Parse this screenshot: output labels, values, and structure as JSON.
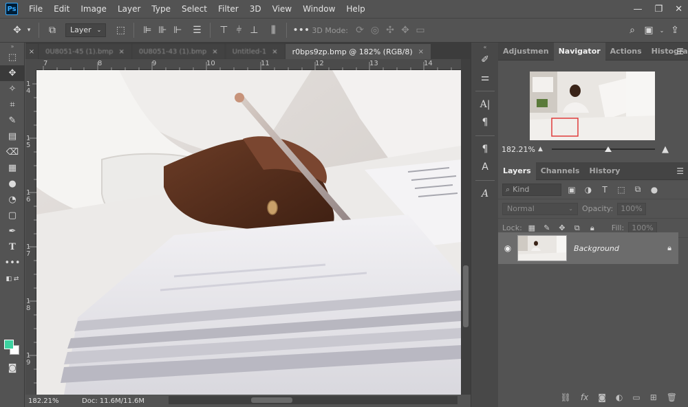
{
  "app": {
    "logo": "Ps",
    "menu": [
      "File",
      "Edit",
      "Image",
      "Layer",
      "Type",
      "Select",
      "Filter",
      "3D",
      "View",
      "Window",
      "Help"
    ],
    "window_controls": [
      "—",
      "❐",
      "✕"
    ]
  },
  "options_bar": {
    "auto_select_value": "Layer",
    "mode_3d_label": "3D Mode:"
  },
  "document": {
    "tabs": [
      {
        "label": "0U8051-45 (1).bmp",
        "active": false
      },
      {
        "label": "0U8051-43 (1).bmp",
        "active": false
      },
      {
        "label": "Untitled-1",
        "active": false
      },
      {
        "label": "r0bps9zp.bmp @ 182% (RGB/8)",
        "active": true
      }
    ],
    "ruler_top": [
      "7",
      "8",
      "9",
      "10",
      "11",
      "12",
      "13",
      "14"
    ],
    "ruler_left": [
      "1\n4",
      "1\n5",
      "1\n6",
      "1\n7",
      "1\n8",
      "1\n9"
    ],
    "status_zoom": "182.21%",
    "status_doc": "Doc: 11.6M/11.6M"
  },
  "panels": {
    "top_tabs": [
      "Adjustmen",
      "Navigator",
      "Actions",
      "Histogram"
    ],
    "active_top_tab": "Navigator",
    "navigator_zoom": "182.21%",
    "layers_tabs": [
      "Layers",
      "Channels",
      "History"
    ],
    "active_layers_tab": "Layers",
    "filter_label": "Kind",
    "blend_mode": "Normal",
    "opacity_label": "Opacity:",
    "opacity_value": "100%",
    "lock_label": "Lock:",
    "fill_label": "Fill:",
    "fill_value": "100%",
    "layer_name": "Background"
  },
  "colors": {
    "foreground": "#3dd2a0",
    "background": "#ffffff",
    "accent": "#31a8ff"
  }
}
